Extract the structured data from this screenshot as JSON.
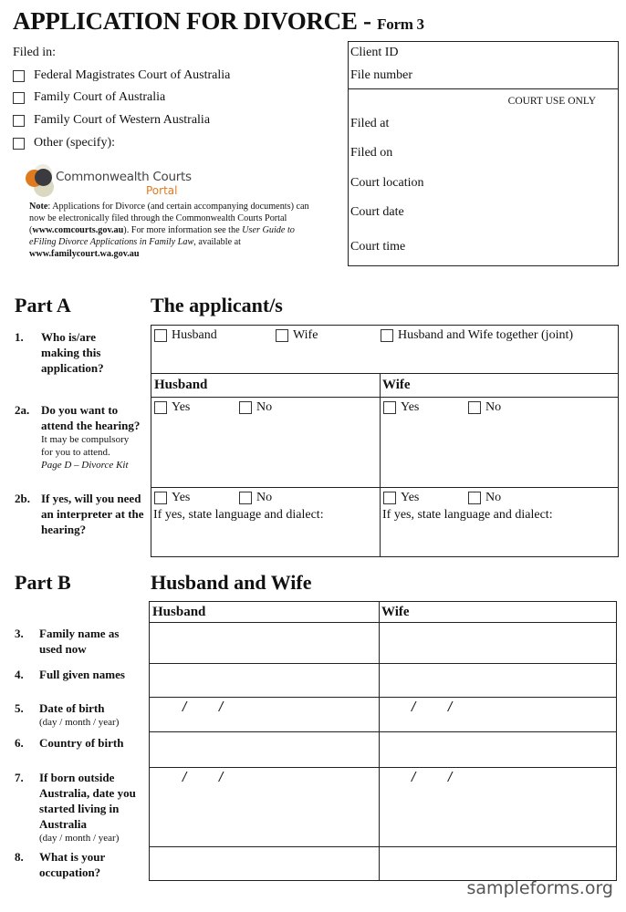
{
  "header": {
    "title": "APPLICATION FOR DIVORCE - ",
    "form_label": "Form 3"
  },
  "filed_in": {
    "label": "Filed in:",
    "options": [
      {
        "label": "Federal Magistrates Court of Australia",
        "checked": false
      },
      {
        "label": "Family Court of Australia",
        "checked": false
      },
      {
        "label": "Family Court of Western Australia",
        "checked": false
      },
      {
        "label": "Other (specify):",
        "checked": false
      }
    ]
  },
  "logo": {
    "line1": "Commonwealth Courts",
    "line2": "Portal"
  },
  "note": {
    "bold_prefix": "Note",
    "text1": ": Applications for Divorce (and certain  accompanying documents) can now be electronically filed through the Commonwealth Courts Portal (",
    "link1": "www.comcourts.gov.au",
    "text2": "). For more information see the ",
    "guide": "User Guide to eFiling Divorce Applications in Family Law",
    "text3": ", available at ",
    "link2": "www.familycourt.wa.gov.au"
  },
  "court_use": {
    "client_id": "Client ID",
    "file_number": "File number",
    "court_use_only": "COURT USE ONLY",
    "filed_at": "Filed at",
    "filed_on": "Filed on",
    "court_location": "Court location",
    "court_date": "Court date",
    "court_time": "Court time"
  },
  "part_a": {
    "label": "Part A",
    "title": "The applicant/s",
    "q1": {
      "num": "1.",
      "text": "Who is/are making this application?",
      "options": [
        "Husband",
        "Wife",
        "Husband and Wife together (joint)"
      ]
    },
    "col_headers": [
      "Husband",
      "Wife"
    ],
    "q2a": {
      "num": "2a.",
      "text": "Do you want to attend the hearing?",
      "sub1": "It may be compulsory for you to attend.",
      "sub2": "Page D – Divorce Kit",
      "yes": "Yes",
      "no": "No"
    },
    "q2b": {
      "num": "2b.",
      "text": "If yes, will you need an interpreter at the hearing?",
      "yes": "Yes",
      "no": "No",
      "language_prompt": "If yes, state language and dialect:"
    }
  },
  "part_b": {
    "label": "Part B",
    "title": "Husband and Wife",
    "col_headers": [
      "Husband",
      "Wife"
    ],
    "questions": [
      {
        "num": "3.",
        "text": "Family name as used now",
        "sub": ""
      },
      {
        "num": "4.",
        "text": "Full given names",
        "sub": ""
      },
      {
        "num": "5.",
        "text": "Date of birth",
        "sub": "(day / month / year)"
      },
      {
        "num": "6.",
        "text": "Country of birth",
        "sub": ""
      },
      {
        "num": "7.",
        "text": "If born outside Australia, date you started living in Australia",
        "sub": "(day / month / year)"
      },
      {
        "num": "8.",
        "text": "What is your occupation?",
        "sub": ""
      }
    ],
    "date_slash": "/"
  },
  "watermark": "sampleforms.org"
}
